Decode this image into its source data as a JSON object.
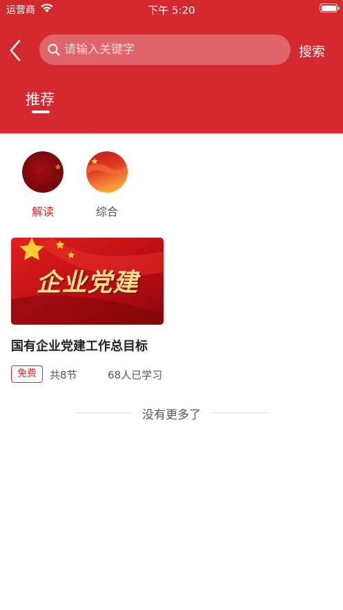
{
  "status_bar": {
    "carrier": "运营商",
    "time": "下午 5:20"
  },
  "header": {
    "search_placeholder": "请输入关键字",
    "search_button": "搜索",
    "tabs": [
      {
        "label": "推荐",
        "active": true
      }
    ],
    "background_color": "#d42a2f"
  },
  "categories": [
    {
      "label": "解读",
      "active": true
    },
    {
      "label": "综合",
      "active": false
    }
  ],
  "courses": [
    {
      "cover_text": "企业党建",
      "title": "国有企业党建工作总目标",
      "badge": "免费",
      "lessons": "共8节",
      "learners": "68人已学习"
    }
  ],
  "footer_text": "没有更多了",
  "accent_color": "#d42a2f"
}
